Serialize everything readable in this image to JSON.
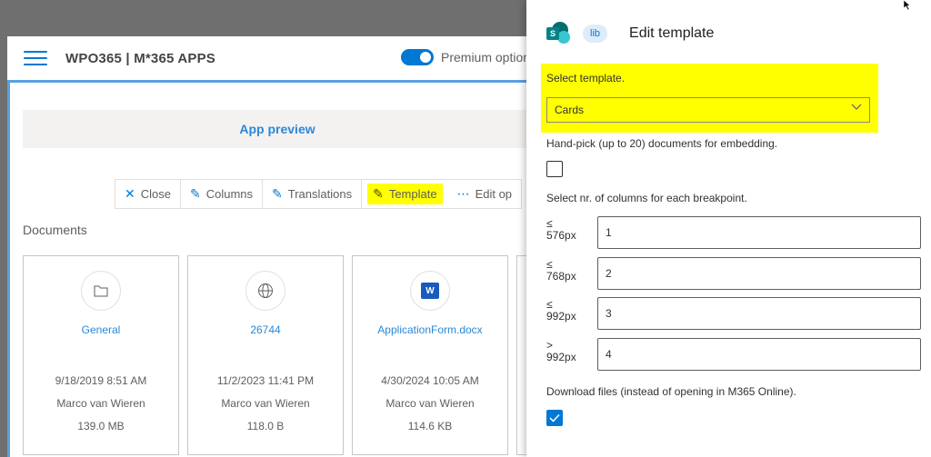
{
  "app": {
    "title": "WPO365 | M*365 APPS",
    "premium_label": "Premium options",
    "preview_label": "App preview",
    "commands": [
      {
        "label": "Close",
        "icon": "✕"
      },
      {
        "label": "Columns",
        "icon": "✎"
      },
      {
        "label": "Translations",
        "icon": "✎"
      },
      {
        "label": "Template",
        "icon": "✎"
      },
      {
        "label": "Edit op",
        "icon": "⋯"
      }
    ],
    "documents_label": "Documents",
    "cards": [
      {
        "name": "General",
        "date": "9/18/2019 8:51 AM",
        "author": "Marco van Wieren",
        "size": "139.0 MB",
        "icon": "folder-icon"
      },
      {
        "name": "26744",
        "date": "11/2/2023 11:41 PM",
        "author": "Marco van Wieren",
        "size": "118.0 B",
        "icon": "globe-icon"
      },
      {
        "name": "ApplicationForm.docx",
        "date": "4/30/2024 10:05 AM",
        "author": "Marco van Wieren",
        "size": "114.6 KB",
        "icon": "word-icon"
      }
    ]
  },
  "panel": {
    "badge": "lib",
    "title": "Edit template",
    "select_label": "Select template.",
    "selected_template": "Cards",
    "handpick_label": "Hand-pick (up to 20) documents for embedding.",
    "columns_label": "Select nr. of columns for each breakpoint.",
    "breakpoints": [
      {
        "op": "≤",
        "px": "576px",
        "value": "1"
      },
      {
        "op": "≤",
        "px": "768px",
        "value": "2"
      },
      {
        "op": "≤",
        "px": "992px",
        "value": "3"
      },
      {
        "op": ">",
        "px": "992px",
        "value": "4"
      }
    ],
    "download_label": "Download files (instead of opening in M365 Online)."
  }
}
